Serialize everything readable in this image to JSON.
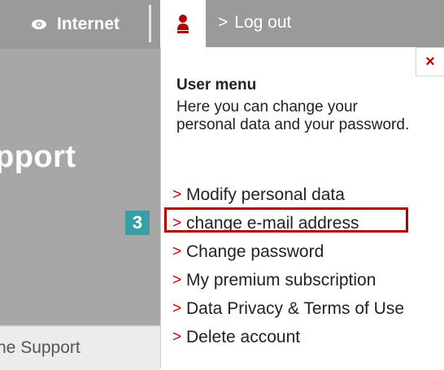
{
  "nav": {
    "internet_label": "Internet",
    "logout_label": "Log out",
    "chevron": ">"
  },
  "background": {
    "heading_fragment": "pport",
    "footer_fragment": "ne Support"
  },
  "user_menu": {
    "close_symbol": "×",
    "title": "User menu",
    "description": "Here you can change your personal data and your password.",
    "items": [
      {
        "label": "Modify personal data"
      },
      {
        "label": "change e-mail address"
      },
      {
        "label": "Change password"
      },
      {
        "label": "My premium subscription"
      },
      {
        "label": "Data Privacy & Terms of Use"
      },
      {
        "label": "Delete account"
      }
    ],
    "highlighted_index": 1,
    "step_badge": "3"
  },
  "colors": {
    "accent_red": "#b00000",
    "badge_teal": "#3a9ea6",
    "nav_gray": "#9a9a9a"
  },
  "icons": {
    "internet": "eye-icon",
    "user": "user-icon",
    "close": "close-icon",
    "menu_chevron": "chevron-right-icon"
  }
}
